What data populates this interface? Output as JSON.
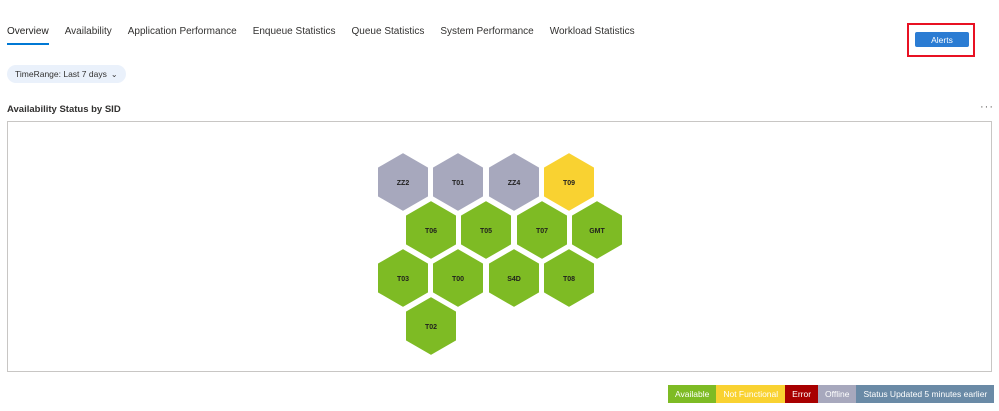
{
  "tabs": [
    {
      "label": "Overview",
      "active": true
    },
    {
      "label": "Availability",
      "active": false
    },
    {
      "label": "Application Performance",
      "active": false
    },
    {
      "label": "Enqueue Statistics",
      "active": false
    },
    {
      "label": "Queue Statistics",
      "active": false
    },
    {
      "label": "System Performance",
      "active": false
    },
    {
      "label": "Workload Statistics",
      "active": false
    }
  ],
  "alerts": {
    "label": "Alerts"
  },
  "time_range": {
    "label": "TimeRange: Last 7 days",
    "icon": "chevron-down-icon"
  },
  "section": {
    "title": "Availability Status by SID",
    "more_icon": "ellipsis-icon"
  },
  "status_colors": {
    "Available": "#7ebb24",
    "Not Functional": "#f9d231",
    "Error": "#a80000",
    "Offline": "#a7a8bd"
  },
  "hexes": [
    {
      "label": "ZZ2",
      "status": "Offline"
    },
    {
      "label": "T01",
      "status": "Offline"
    },
    {
      "label": "ZZ4",
      "status": "Offline"
    },
    {
      "label": "T09",
      "status": "Not Functional"
    },
    {
      "label": "T06",
      "status": "Available"
    },
    {
      "label": "T05",
      "status": "Available"
    },
    {
      "label": "T07",
      "status": "Available"
    },
    {
      "label": "GMT",
      "status": "Available"
    },
    {
      "label": "T03",
      "status": "Available"
    },
    {
      "label": "T00",
      "status": "Available"
    },
    {
      "label": "S4D",
      "status": "Available"
    },
    {
      "label": "T08",
      "status": "Available"
    },
    {
      "label": "T02",
      "status": "Available"
    }
  ],
  "legend": [
    {
      "label": "Available",
      "color": "#7ebb24"
    },
    {
      "label": "Not Functional",
      "color": "#f9d231"
    },
    {
      "label": "Error",
      "color": "#a80000"
    },
    {
      "label": "Offline",
      "color": "#a7a8bd"
    },
    {
      "label": "Status Updated 5 minutes earlier",
      "color": "#6a8aa6"
    }
  ]
}
